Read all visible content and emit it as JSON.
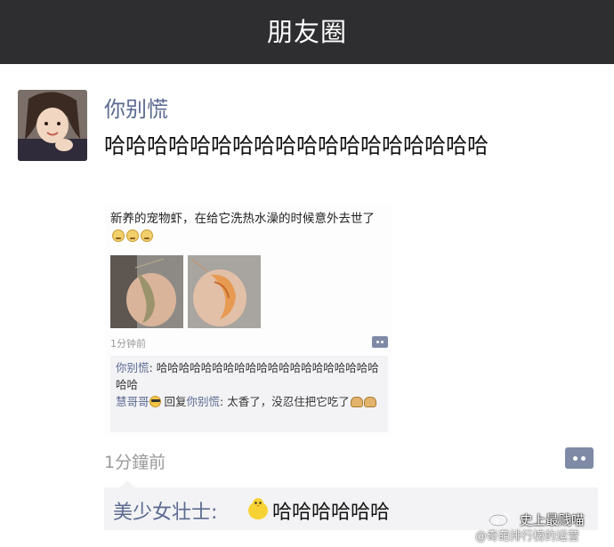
{
  "header": {
    "title": "朋友圈"
  },
  "post": {
    "author": "你别慌",
    "text": "哈哈哈哈哈哈哈哈哈哈哈哈哈哈哈哈哈哈",
    "time": "1分鐘前",
    "shared_screenshot": {
      "text": "新养的宠物虾，在给它洗热水澡的时候意外去世了",
      "time": "1分钟前",
      "comments": [
        {
          "name": "你别慌",
          "sep": ": ",
          "text": "哈哈哈哈哈哈哈哈哈哈哈哈哈哈哈哈哈哈哈哈哈哈"
        },
        {
          "name": "慧哥哥",
          "reply_word": " 回复",
          "reply_to": "你别慌",
          "sep": ": ",
          "text": "太香了，没忍住把它吃了"
        }
      ]
    }
  },
  "comment": {
    "name": "美少女壮士:",
    "text": "哈哈哈哈哈哈"
  },
  "watermark": {
    "line1": "史上最贱喵",
    "line2": "@奇葩排行榜的运营"
  }
}
